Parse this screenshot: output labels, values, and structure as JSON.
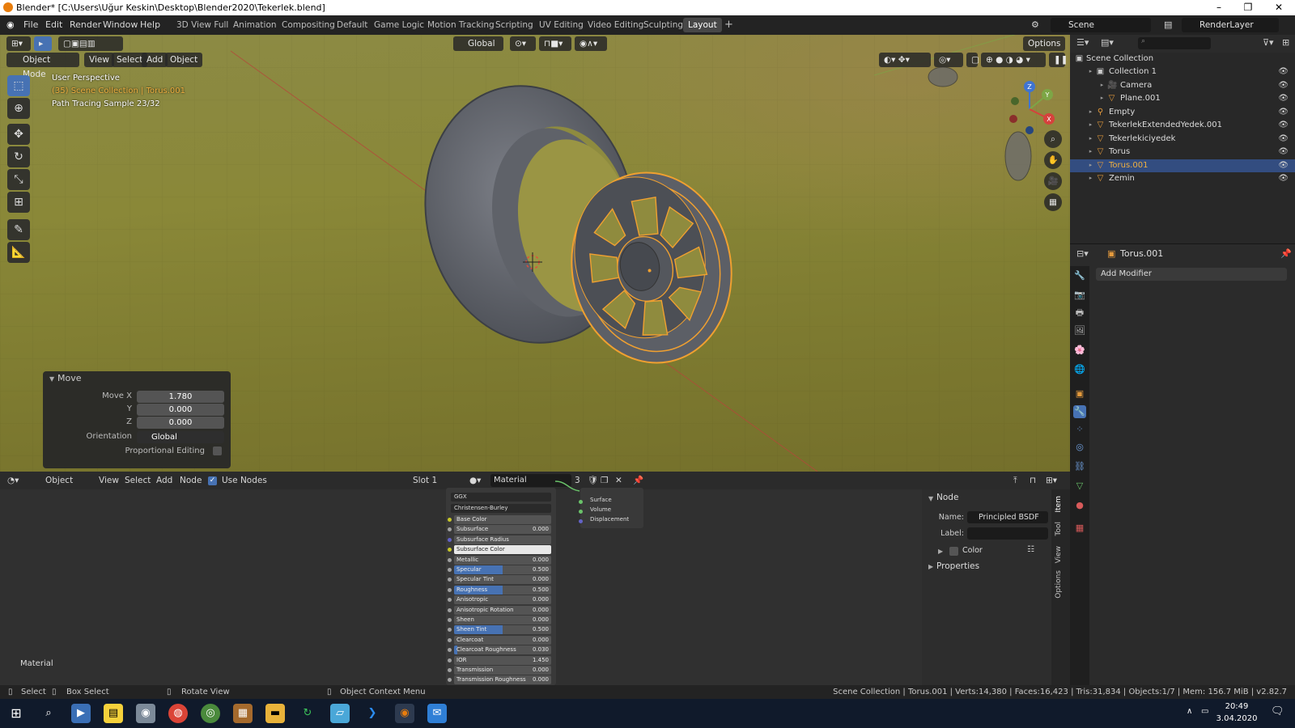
{
  "window": {
    "title": "Blender* [C:\\Users\\Uğur Keskin\\Desktop\\Blender2020\\Tekerlek.blend]",
    "controls": [
      "–",
      "❐",
      "✕"
    ]
  },
  "menubar": {
    "menus": [
      "File",
      "Edit",
      "Render",
      "Window",
      "Help"
    ],
    "workspaces": [
      "3D View Full",
      "Animation",
      "Compositing",
      "Default",
      "Game Logic",
      "Motion Tracking",
      "Scripting",
      "UV Editing",
      "Video Editing",
      "Sculpting",
      "Layout"
    ],
    "active_workspace": "Layout",
    "scene": "Scene",
    "render_layer": "RenderLayer"
  },
  "viewport": {
    "mode": "Object Mode",
    "menus": [
      "View",
      "Select",
      "Add",
      "Object"
    ],
    "orientation": "Global",
    "options_label": "Options",
    "overlay_lines": [
      "User Perspective",
      "(35) Scene Collection | Torus.001",
      "Path Tracing Sample 23/32"
    ],
    "gizmo_axes": [
      "Z",
      "Y",
      "X"
    ]
  },
  "move_panel": {
    "title": "Move",
    "labels": [
      "Move X",
      "Y",
      "Z"
    ],
    "values": [
      "1.780",
      "0.000",
      "0.000"
    ],
    "orientation_label": "Orientation",
    "orientation_value": "Global",
    "proportional_label": "Proportional Editing"
  },
  "outliner": {
    "root": "Scene Collection",
    "items": [
      {
        "name": "Collection 1",
        "indent": 1,
        "selected": false
      },
      {
        "name": "Camera",
        "indent": 2,
        "selected": false
      },
      {
        "name": "Plane.001",
        "indent": 2,
        "selected": false
      },
      {
        "name": "Empty",
        "indent": 1,
        "selected": false
      },
      {
        "name": "TekerlekExtendedYedek.001",
        "indent": 1,
        "selected": false
      },
      {
        "name": "Tekerlekiciyedek",
        "indent": 1,
        "selected": false
      },
      {
        "name": "Torus",
        "indent": 1,
        "selected": false
      },
      {
        "name": "Torus.001",
        "indent": 1,
        "selected": true
      },
      {
        "name": "Zemin",
        "indent": 1,
        "selected": false
      }
    ]
  },
  "properties": {
    "object_name": "Torus.001",
    "add_modifier_label": "Add Modifier"
  },
  "node_editor": {
    "editor_type": "Object",
    "menus": [
      "View",
      "Select",
      "Add",
      "Node"
    ],
    "use_nodes_label": "Use Nodes",
    "slot": "Slot 1",
    "material": "Material",
    "user_count": "3",
    "frame_label": "Material",
    "bsdf": {
      "distribution": "GGX",
      "subsurface_method": "Christensen-Burley",
      "rows": [
        {
          "name": "Base Color",
          "value": "",
          "fill": 0
        },
        {
          "name": "Subsurface",
          "value": "0.000",
          "fill": 0
        },
        {
          "name": "Subsurface Radius",
          "value": "",
          "fill": 0
        },
        {
          "name": "Subsurface Color",
          "value": "",
          "fill": 0
        },
        {
          "name": "Metallic",
          "value": "0.000",
          "fill": 0
        },
        {
          "name": "Specular",
          "value": "0.500",
          "fill": 0.5
        },
        {
          "name": "Specular Tint",
          "value": "0.000",
          "fill": 0
        },
        {
          "name": "Roughness",
          "value": "0.500",
          "fill": 0.5
        },
        {
          "name": "Anisotropic",
          "value": "0.000",
          "fill": 0
        },
        {
          "name": "Anisotropic Rotation",
          "value": "0.000",
          "fill": 0
        },
        {
          "name": "Sheen",
          "value": "0.000",
          "fill": 0
        },
        {
          "name": "Sheen Tint",
          "value": "0.500",
          "fill": 0.5
        },
        {
          "name": "Clearcoat",
          "value": "0.000",
          "fill": 0
        },
        {
          "name": "Clearcoat Roughness",
          "value": "0.030",
          "fill": 0.03
        },
        {
          "name": "IOR",
          "value": "1.450",
          "fill": 0
        },
        {
          "name": "Transmission",
          "value": "0.000",
          "fill": 0
        },
        {
          "name": "Transmission Roughness",
          "value": "0.000",
          "fill": 0
        }
      ]
    },
    "output_sockets": [
      "Surface",
      "Volume",
      "Displacement"
    ],
    "sidebar": {
      "section": "Node",
      "name_label": "Name:",
      "name_value": "Principled BSDF",
      "label_label": "Label:",
      "color_label": "Color",
      "properties_label": "Properties",
      "tabs": [
        "Item",
        "Tool",
        "View",
        "Options"
      ]
    }
  },
  "statusbar": {
    "select": "Select",
    "box_select": "Box Select",
    "rotate_view": "Rotate View",
    "context_menu": "Object Context Menu",
    "stats": "Scene Collection | Torus.001 | Verts:14,380 | Faces:16,423 | Tris:31,834 | Objects:1/7 | Mem: 156.7 MiB | v2.82.7"
  },
  "taskbar": {
    "time": "20:49",
    "date": "3.04.2020"
  },
  "colors": {
    "accent": "#4772b3",
    "selection_orange": "#f0a030",
    "outliner_selected": "#334d80"
  }
}
